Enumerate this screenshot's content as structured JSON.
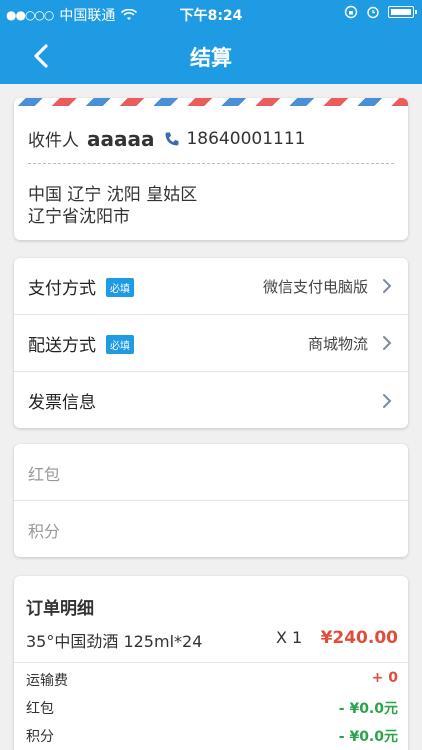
{
  "status": {
    "carrier": "中国联通",
    "time": "下午8:24"
  },
  "nav": {
    "title": "结算"
  },
  "address": {
    "label": "收件人",
    "name": "aaaaa",
    "phone": "18640001111",
    "region": "中国 辽宁 沈阳 皇姑区",
    "detail": "辽宁省沈阳市"
  },
  "settings": [
    {
      "label": "支付方式",
      "badge": "必填",
      "value": "微信支付电脑版"
    },
    {
      "label": "配送方式",
      "badge": "必填",
      "value": "商城物流"
    },
    {
      "label": "发票信息",
      "badge": "",
      "value": ""
    }
  ],
  "promo": {
    "redpacket": "红包",
    "points": "积分"
  },
  "order": {
    "title": "订单明细",
    "item_name": "35°中国劲酒 125ml*24",
    "item_qty": "X 1",
    "item_price": "¥240.00",
    "fees": [
      {
        "label": "运输费",
        "value": "+ 0"
      },
      {
        "label": "红包",
        "value": "- ¥0.0元"
      },
      {
        "label": "积分",
        "value": "- ¥0.0元"
      }
    ]
  },
  "colors": {
    "brand": "#1f9be3",
    "price": "#e24d3b",
    "discount": "#2aa44a"
  }
}
